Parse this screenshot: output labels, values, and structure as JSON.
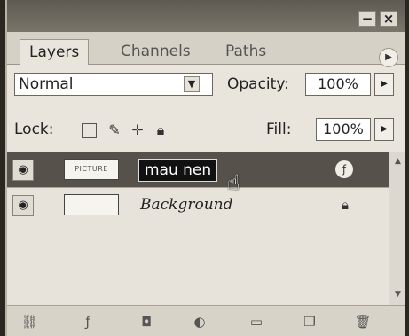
{
  "tabs": [
    {
      "label": "Layers",
      "active": true
    },
    {
      "label": "Channels",
      "active": false
    },
    {
      "label": "Paths",
      "active": false
    }
  ],
  "window_controls": {
    "minimize": "−",
    "close": "×"
  },
  "blend_mode": {
    "value": "Normal"
  },
  "opacity": {
    "label": "Opacity:",
    "value": "100%"
  },
  "lock": {
    "label": "Lock:",
    "icons": [
      "lock-transparent-icon",
      "lock-image-icon",
      "lock-position-icon",
      "lock-all-icon"
    ]
  },
  "fill": {
    "label": "Fill:",
    "value": "100%"
  },
  "layers": [
    {
      "name": "mau nen",
      "thumb_text": "PICTURE",
      "selected": true,
      "badge": "fx-icon"
    },
    {
      "name": "Background",
      "thumb_text": "",
      "selected": false,
      "badge": "lock-icon"
    }
  ],
  "bottom_icons": [
    "link-icon",
    "fx-icon",
    "mask-icon",
    "adjustment-icon",
    "folder-icon",
    "new-layer-icon",
    "trash-icon"
  ],
  "colors": {
    "selected_row": "#56524b",
    "panel": "#e9e5dc"
  }
}
